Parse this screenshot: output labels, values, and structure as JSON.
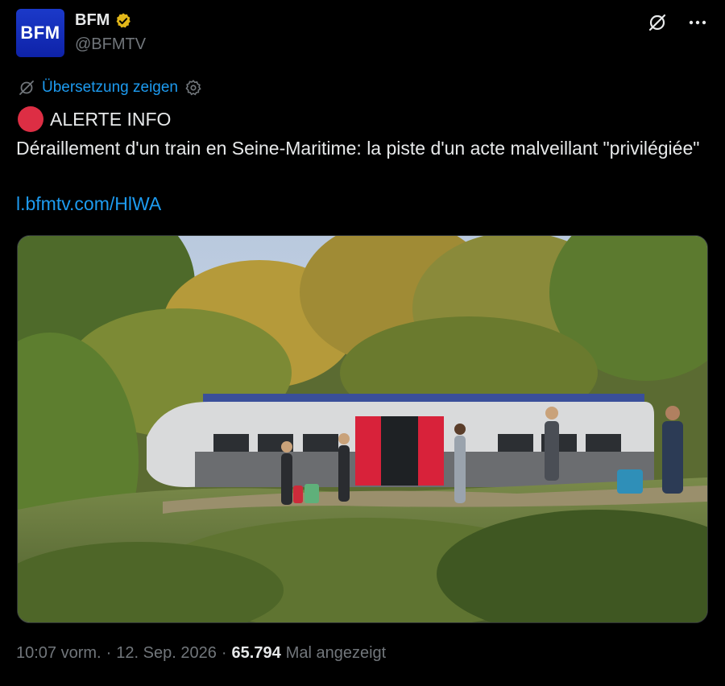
{
  "account": {
    "avatar_text": "BFM",
    "display_name": "BFM",
    "handle": "@BFMTV",
    "verified_badge_color": "#e2b719"
  },
  "translate": {
    "label": "Übersetzung zeigen"
  },
  "post": {
    "alert_label": "ALERTE INFO",
    "headline": "Déraillement d'un train en Seine-Maritime: la piste d'un acte malveillant \"privilégiée\"",
    "link": "l.bfmtv.com/HlWA"
  },
  "meta": {
    "time": "10:07 vorm.",
    "separator1": "·",
    "date": "12. Sep. 2026",
    "separator2": "·",
    "view_count": "65.794",
    "views_label": "Mal angezeigt"
  },
  "colors": {
    "background": "#000000",
    "text": "#e7e9ea",
    "muted": "#71767b",
    "link": "#1d9bf0",
    "alert_dot": "#dd2e44",
    "avatar_blue": "#1b39c9"
  },
  "icons": [
    "verified-badge-icon",
    "grok-icon",
    "more-icon",
    "translate-icon",
    "settings-icon",
    "red-circle-icon"
  ]
}
